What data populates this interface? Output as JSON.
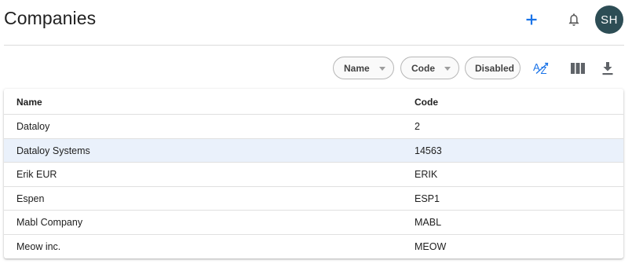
{
  "header": {
    "title": "Companies",
    "add_icon": "plus-icon",
    "notifications_icon": "bell-icon",
    "avatar_initials": "SH",
    "avatar_color": "#2d4d55",
    "accent_color": "#1a73e8"
  },
  "toolbar": {
    "filters": [
      {
        "label": "Name",
        "has_dropdown": true
      },
      {
        "label": "Code",
        "has_dropdown": true
      },
      {
        "label": "Disabled",
        "has_dropdown": false
      }
    ],
    "sort_icon": "sort-az-icon",
    "columns_icon": "view-columns-icon",
    "download_icon": "download-icon"
  },
  "table": {
    "columns": [
      "Name",
      "Code"
    ],
    "rows": [
      {
        "name": "Dataloy",
        "code": "2"
      },
      {
        "name": "Dataloy Systems",
        "code": "14563",
        "selected": true
      },
      {
        "name": "Erik EUR",
        "code": "ERIK"
      },
      {
        "name": "Espen",
        "code": "ESP1"
      },
      {
        "name": "Mabl Company",
        "code": "MABL"
      },
      {
        "name": "Meow inc.",
        "code": "MEOW"
      }
    ],
    "selected_row_color": "#eaf1fb"
  }
}
